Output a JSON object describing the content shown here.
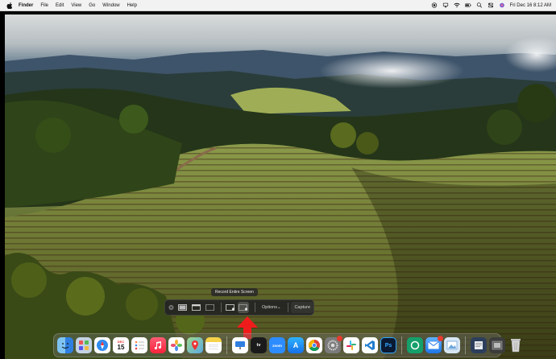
{
  "menubar": {
    "app_name": "Finder",
    "items": [
      "File",
      "Edit",
      "View",
      "Go",
      "Window",
      "Help"
    ],
    "clock": "Fri Dec 16  8:12 AM"
  },
  "capture_toolbar": {
    "tooltip": "Record Entire Screen",
    "options_label": "Options",
    "capture_label": "Capture",
    "buttons": [
      "close",
      "capture-entire-screen",
      "capture-selected-window",
      "capture-selected-portion",
      "record-entire-screen",
      "record-selected-portion"
    ],
    "active_button": "record-entire-screen"
  },
  "dock": {
    "calendar": {
      "month": "DEC",
      "day": "15"
    },
    "icons": [
      {
        "name": "finder-icon",
        "color": "#3a8ee6",
        "label": ""
      },
      {
        "name": "launchpad-icon",
        "color": "#8aa8c8",
        "label": ""
      },
      {
        "name": "safari-icon",
        "color": "#2f8cf0",
        "label": ""
      },
      {
        "name": "calendar-icon",
        "color": "#ffffff",
        "label": ""
      },
      {
        "name": "reminders-icon",
        "color": "#ffffff",
        "label": ""
      },
      {
        "name": "music-icon",
        "color": "#fa4460",
        "label": ""
      },
      {
        "name": "photos-icon",
        "color": "#ffffff",
        "label": ""
      },
      {
        "name": "maps-icon",
        "color": "#5fb35a",
        "label": ""
      },
      {
        "name": "notes-icon",
        "color": "#f6d24a",
        "label": ""
      },
      {
        "name": "keynote-icon",
        "color": "#ffffff",
        "label": ""
      },
      {
        "name": "appletv-icon",
        "color": "#1b1b1b",
        "label": "tv"
      },
      {
        "name": "zoom-icon",
        "color": "#2d8cff",
        "label": "zoom"
      },
      {
        "name": "appstore-icon",
        "color": "#1f8ef1",
        "label": "A"
      },
      {
        "name": "chrome-icon",
        "color": "#ffffff",
        "label": ""
      },
      {
        "name": "system-settings-icon",
        "color": "#8a8a8a",
        "label": ""
      },
      {
        "name": "slack-icon",
        "color": "#ffffff",
        "label": ""
      },
      {
        "name": "vscode-icon",
        "color": "#1f7bd0",
        "label": ""
      },
      {
        "name": "photoshop-icon",
        "color": "#0a1a33",
        "label": "Ps"
      },
      {
        "name": "grammarly-icon",
        "color": "#15a06b",
        "label": ""
      },
      {
        "name": "mail-icon",
        "color": "#3a8ee6",
        "label": ""
      },
      {
        "name": "preview-icon",
        "color": "#6fa7dc",
        "label": ""
      },
      {
        "name": "folder-icon",
        "color": "#4a6a9c",
        "label": ""
      },
      {
        "name": "screenshot-icon",
        "color": "#555555",
        "label": ""
      },
      {
        "name": "trash-icon",
        "color": "#c9c9c9",
        "label": ""
      }
    ]
  }
}
